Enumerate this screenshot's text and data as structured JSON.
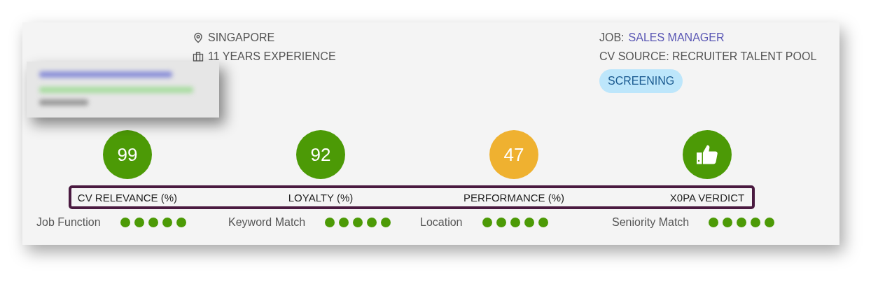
{
  "location": "SINGAPORE",
  "experience": "11 YEARS EXPERIENCE",
  "job": {
    "label": "JOB:",
    "value": "SALES MANAGER"
  },
  "cv_source": "CV SOURCE: RECRUITER TALENT POOL",
  "status": "SCREENING",
  "scores": [
    {
      "kind": "number",
      "value": "99",
      "label": "CV RELEVANCE (%)",
      "color": "#4c9a06"
    },
    {
      "kind": "number",
      "value": "92",
      "label": "LOYALTY (%)",
      "color": "#4c9a06"
    },
    {
      "kind": "number",
      "value": "47",
      "label": "PERFORMANCE (%)",
      "color": "#efb130"
    },
    {
      "kind": "icon",
      "label": "X0PA VERDICT",
      "color": "#4c9a06"
    }
  ],
  "criteria": [
    {
      "name": "Job Function",
      "stars": 5
    },
    {
      "name": "Keyword Match",
      "stars": 5
    },
    {
      "name": "Location",
      "stars": 5
    },
    {
      "name": "Seniority Match",
      "stars": 5
    }
  ]
}
